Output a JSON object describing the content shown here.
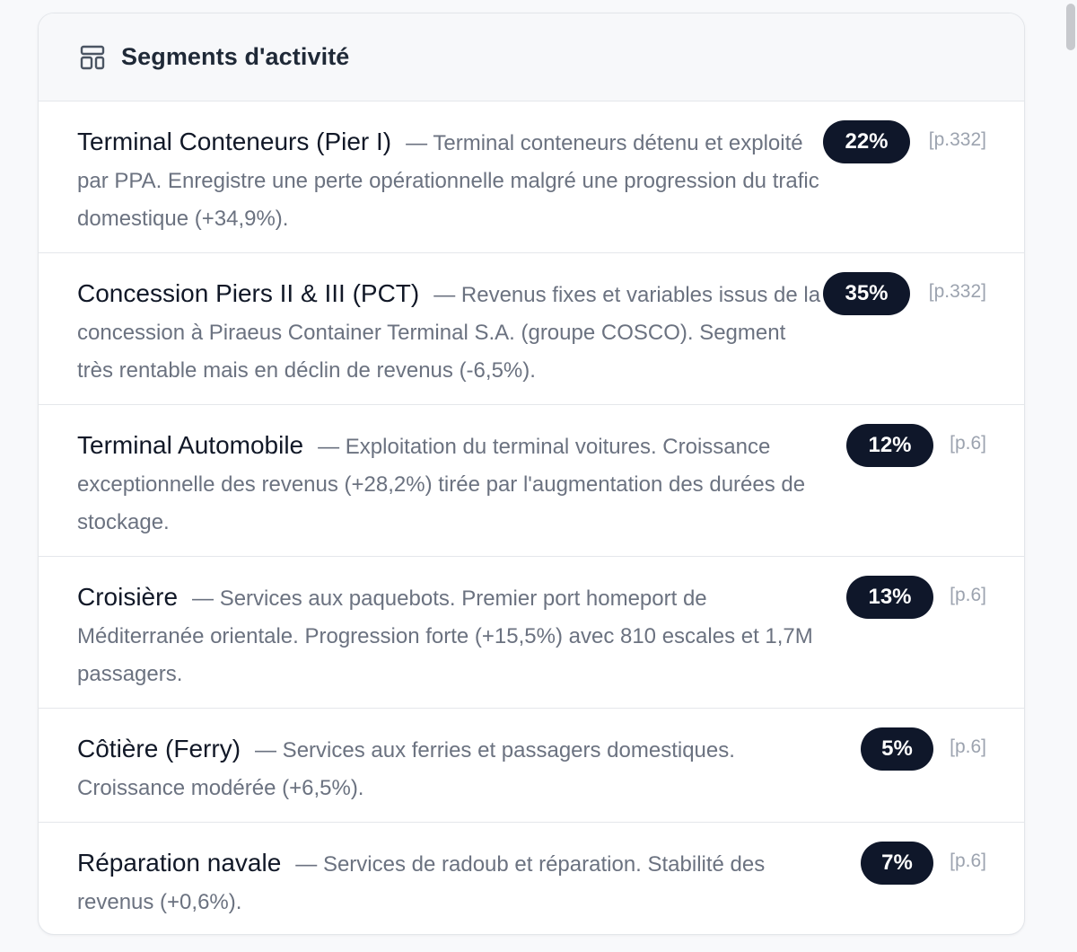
{
  "header": {
    "title": "Segments d'activité",
    "icon": "layout-icon"
  },
  "segments": [
    {
      "name": "Terminal Conteneurs (Pier I)",
      "description": "— Terminal conteneurs détenu et exploité par PPA. Enregistre une perte opérationnelle malgré une progression du trafic domestique (+34,9%).",
      "share": "22%",
      "page_ref": "[p.332]"
    },
    {
      "name": "Concession Piers II & III (PCT)",
      "description": "— Revenus fixes et variables issus de la concession à Piraeus Container Terminal S.A. (groupe COSCO). Segment très rentable mais en déclin de revenus (-6,5%).",
      "share": "35%",
      "page_ref": "[p.332]"
    },
    {
      "name": "Terminal Automobile",
      "description": "— Exploitation du terminal voitures. Croissance exceptionnelle des revenus (+28,2%) tirée par l'augmentation des durées de stockage.",
      "share": "12%",
      "page_ref": "[p.6]"
    },
    {
      "name": "Croisière",
      "description": "— Services aux paquebots. Premier port homeport de Méditerranée orientale. Progression forte (+15,5%) avec 810 escales et 1,7M passagers.",
      "share": "13%",
      "page_ref": "[p.6]"
    },
    {
      "name": "Côtière (Ferry)",
      "description": "— Services aux ferries et passagers domestiques. Croissance modérée (+6,5%).",
      "share": "5%",
      "page_ref": "[p.6]"
    },
    {
      "name": "Réparation navale",
      "description": "— Services de radoub et réparation. Stabilité des revenus (+0,6%).",
      "share": "7%",
      "page_ref": "[p.6]"
    }
  ]
}
